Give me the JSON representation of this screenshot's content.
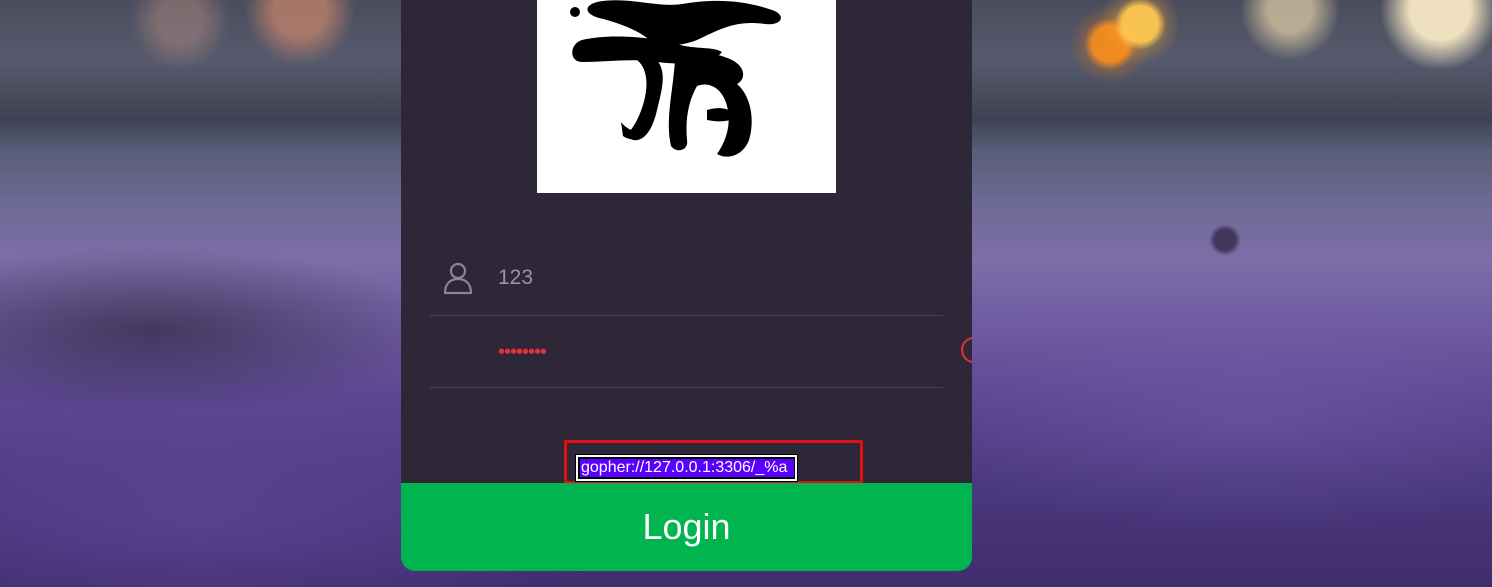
{
  "login_form": {
    "username_value": "123",
    "password_dots": "••••••••",
    "url_field_value": "gopher://127.0.0.1:3306/_%a",
    "login_label": "Login"
  },
  "icons": {
    "user": "user-icon",
    "eye": "eye-icon",
    "logo": "calligraphy-logo"
  },
  "colors": {
    "panel": "#2e2737",
    "login_button": "#00b550",
    "highlight_border": "#e01010",
    "selection": "#5a00ff",
    "password_dots": "#e0303a"
  }
}
